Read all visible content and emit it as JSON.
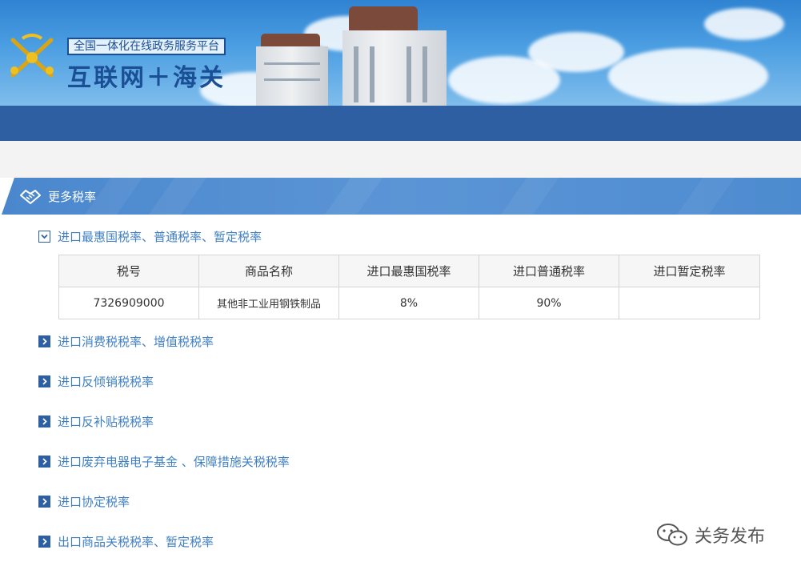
{
  "banner": {
    "platform_label": "全国一体化在线政务服务平台",
    "brand_title": "互联网＋海关"
  },
  "section": {
    "title": "更多税率"
  },
  "items": [
    {
      "label": "进口最惠国税率、普通税率、暂定税率",
      "expanded": true
    },
    {
      "label": "进口消费税税率、增值税税率",
      "expanded": false
    },
    {
      "label": "进口反倾销税税率",
      "expanded": false
    },
    {
      "label": "进口反补贴税税率",
      "expanded": false
    },
    {
      "label": "进口废弃电器电子基金 、保障措施关税税率",
      "expanded": false
    },
    {
      "label": "进口协定税率",
      "expanded": false
    },
    {
      "label": "出口商品关税税率、暂定税率",
      "expanded": false
    }
  ],
  "table": {
    "headers": [
      "税号",
      "商品名称",
      "进口最惠国税率",
      "进口普通税率",
      "进口暂定税率"
    ],
    "rows": [
      [
        "7326909000",
        "其他非工业用钢铁制品",
        "8%",
        "90%",
        ""
      ]
    ]
  },
  "watermark": {
    "text": "关务发布"
  },
  "colors": {
    "primary_blue": "#2d5fa2",
    "link_blue": "#3f7fc4",
    "header_blue": "#4a87cd"
  }
}
